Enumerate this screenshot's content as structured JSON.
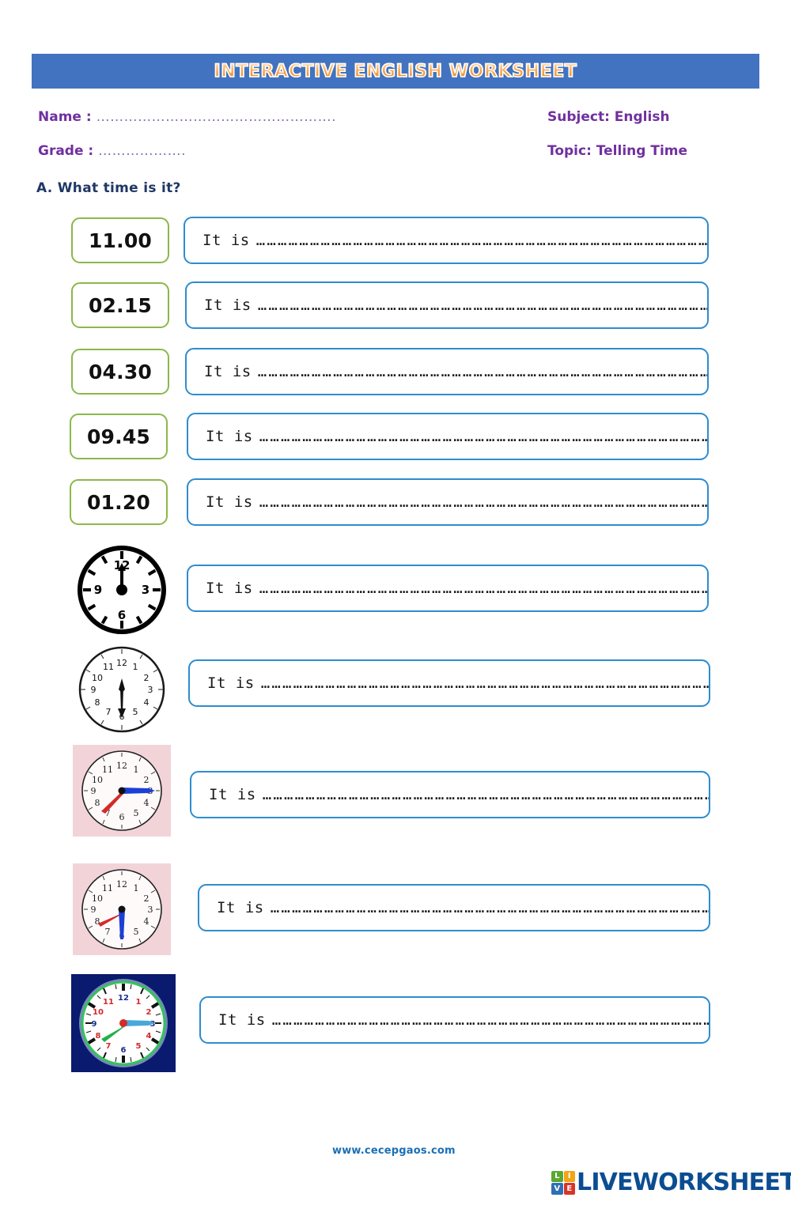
{
  "header": {
    "title": "INTERACTIVE ENGLISH WORKSHEET",
    "bar_color": "#4273c0",
    "title_color": "#f0a24a"
  },
  "meta": {
    "name_label": "Name  :",
    "name_value": "…………………………………………….",
    "grade_label": "Grade  :",
    "grade_value": "……………….",
    "subject": "Subject: English",
    "topic": "Topic: Telling Time",
    "text_color": "#7030a0"
  },
  "section": {
    "heading": "A.  What time is it?",
    "heading_color": "#1f3864"
  },
  "answer_prefix": "It is",
  "dots": "…………………………………………………………………………………………………………………",
  "questions": [
    {
      "kind": "time",
      "time": "11.00",
      "answer_placeholder": ""
    },
    {
      "kind": "time",
      "time": "02.15",
      "answer_placeholder": ""
    },
    {
      "kind": "time",
      "time": "04.30",
      "answer_placeholder": ""
    },
    {
      "kind": "time",
      "time": "09.45",
      "answer_placeholder": ""
    },
    {
      "kind": "time",
      "time": "01.20",
      "answer_placeholder": ""
    },
    {
      "kind": "clock",
      "clock_name": "clock-black-outline-12-00",
      "reads": "12:00",
      "answer_placeholder": ""
    },
    {
      "kind": "clock",
      "clock_name": "clock-white-6-30",
      "reads": "6:30",
      "answer_placeholder": ""
    },
    {
      "kind": "clock",
      "clock_name": "clock-pink-7-15",
      "reads": "7:15",
      "answer_placeholder": ""
    },
    {
      "kind": "clock",
      "clock_name": "clock-pink-8-30",
      "reads": "8:30",
      "answer_placeholder": ""
    },
    {
      "kind": "clock",
      "clock_name": "clock-blue-8-15",
      "reads": "8:15",
      "answer_placeholder": ""
    }
  ],
  "styles": {
    "time_box_border": "#8cb84a",
    "answer_box_border": "#2e8ccf"
  },
  "clock_faces": {
    "c1": {
      "numbers": [
        "12",
        "3",
        "6",
        "9"
      ],
      "bg": "#ffffff",
      "ring": "#000000"
    },
    "c2": {
      "numbers": [
        "12",
        "1",
        "2",
        "3",
        "4",
        "5",
        "6",
        "7",
        "8",
        "9",
        "10",
        "11"
      ],
      "bg": "#ffffff",
      "ring": "#1a1a1a"
    },
    "c3": {
      "numbers": [
        "12",
        "1",
        "2",
        "3",
        "4",
        "5",
        "6",
        "7",
        "8",
        "9",
        "10",
        "11"
      ],
      "bg": "#f2d4d8",
      "hour_hand": "#d42a2a",
      "minute_hand": "#1c3fd6"
    },
    "c4": {
      "numbers": [
        "12",
        "1",
        "2",
        "3",
        "4",
        "5",
        "6",
        "7",
        "8",
        "9",
        "10",
        "11"
      ],
      "bg": "#f2d4d8",
      "hour_hand": "#d42a2a",
      "minute_hand": "#1c3fd6"
    },
    "c5": {
      "numbers": [
        "12",
        "1",
        "2",
        "3",
        "4",
        "5",
        "6",
        "7",
        "8",
        "9",
        "10",
        "11"
      ],
      "bg": "#0a1a6e",
      "ring": "#35c25a",
      "hour_hand": "#22b14c",
      "minute_hand": "#4aa8d8",
      "center": "#d42a2a"
    }
  },
  "footer": {
    "url": "www.cecepgaos.com",
    "url_color": "#1a6fb5",
    "logo_letters": [
      "L",
      "I",
      "V",
      "E"
    ],
    "logo_colors": [
      "#5aa832",
      "#f0a418",
      "#2f6fb5",
      "#d8342a"
    ],
    "logo_word": "LIVEWORKSHEETS",
    "logo_word_color": "#0b4d91"
  }
}
